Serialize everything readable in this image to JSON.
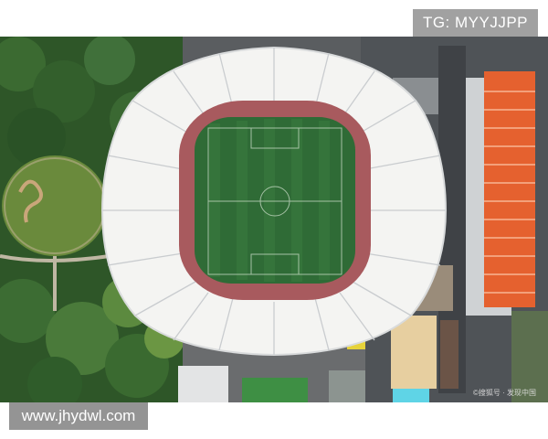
{
  "watermark_top": "TG: MYYJJPP",
  "watermark_bottom": "www.jhydwl.com",
  "corner_watermark": "©搜狐号 · 发现中国",
  "scene": {
    "subject": "stadium-aerial-view",
    "colors": {
      "roof": "#f4f4f2",
      "roof_rib": "#c9cccf",
      "pitch": "#2f6b36",
      "pitch_stripe": "#3a7a3f",
      "stands": "#a85a5e",
      "trees": "#2f5a2a",
      "lawn": "#6e8a3e",
      "roads": "#5b5e62",
      "orange_roof": "#e5612f"
    }
  }
}
